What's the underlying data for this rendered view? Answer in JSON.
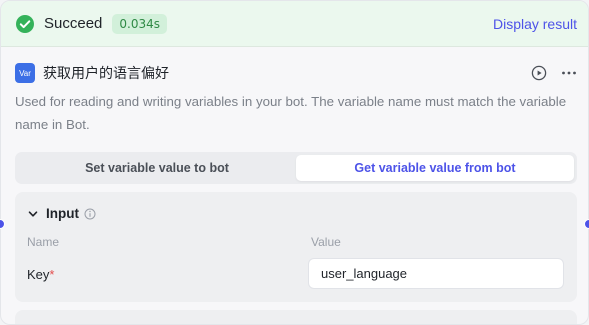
{
  "status": {
    "text": "Succeed",
    "duration": "0.034s",
    "display_result": "Display result",
    "icon": "check-circle-icon",
    "color": "#34b25a"
  },
  "node": {
    "badge": "Var",
    "title": "获取用户的语言偏好",
    "description": "Used for reading and writing variables in your bot. The variable name must match the variable name in Bot.",
    "accent": "#4d53e8"
  },
  "mode_tabs": [
    {
      "label": "Set variable value to bot",
      "active": false
    },
    {
      "label": "Get variable value from bot",
      "active": true
    }
  ],
  "input": {
    "title": "Input",
    "columns": {
      "name": "Name",
      "value": "Value"
    },
    "rows": [
      {
        "key": "Key",
        "required_mark": "*",
        "value": "user_language"
      }
    ]
  }
}
